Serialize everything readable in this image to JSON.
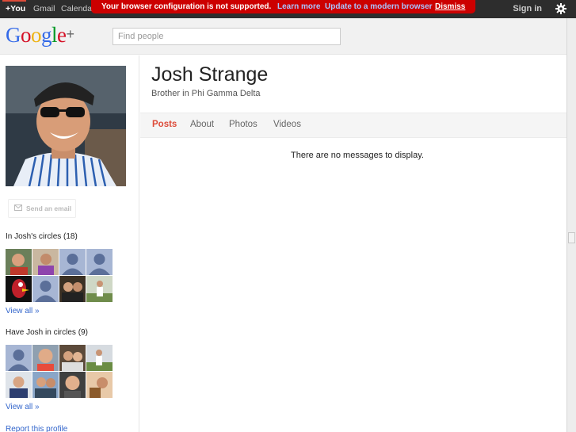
{
  "topbar": {
    "you": "+You",
    "gmail": "Gmail",
    "calendar": "Calendar",
    "sign_in": "Sign in",
    "settings_icon": "gear-icon"
  },
  "warning": {
    "message": "Your browser configuration is not supported.",
    "learn_more": "Learn more",
    "update": "Update to a modern browser",
    "dismiss": "Dismiss"
  },
  "header": {
    "logo_letters": [
      "G",
      "o",
      "o",
      "g",
      "l",
      "e"
    ],
    "logo_plus": "+",
    "search_placeholder": "Find people"
  },
  "profile": {
    "name": "Josh Strange",
    "tagline": "Brother in Phi Gamma Delta",
    "send_email": "Send an email"
  },
  "tabs": [
    {
      "label": "Posts",
      "active": true
    },
    {
      "label": "About",
      "active": false
    },
    {
      "label": "Photos",
      "active": false
    },
    {
      "label": "Videos",
      "active": false
    }
  ],
  "main": {
    "empty_message": "There are no messages to display."
  },
  "circles": {
    "in_title": "In Josh's circles (18)",
    "in_view_all": "View all »",
    "have_title": "Have Josh in circles (9)",
    "have_view_all": "View all »"
  },
  "footer": {
    "report": "Report this profile"
  },
  "colors": {
    "accent_red": "#dd4b39",
    "banner_red": "#cc0000",
    "link_blue": "#3366cc"
  }
}
